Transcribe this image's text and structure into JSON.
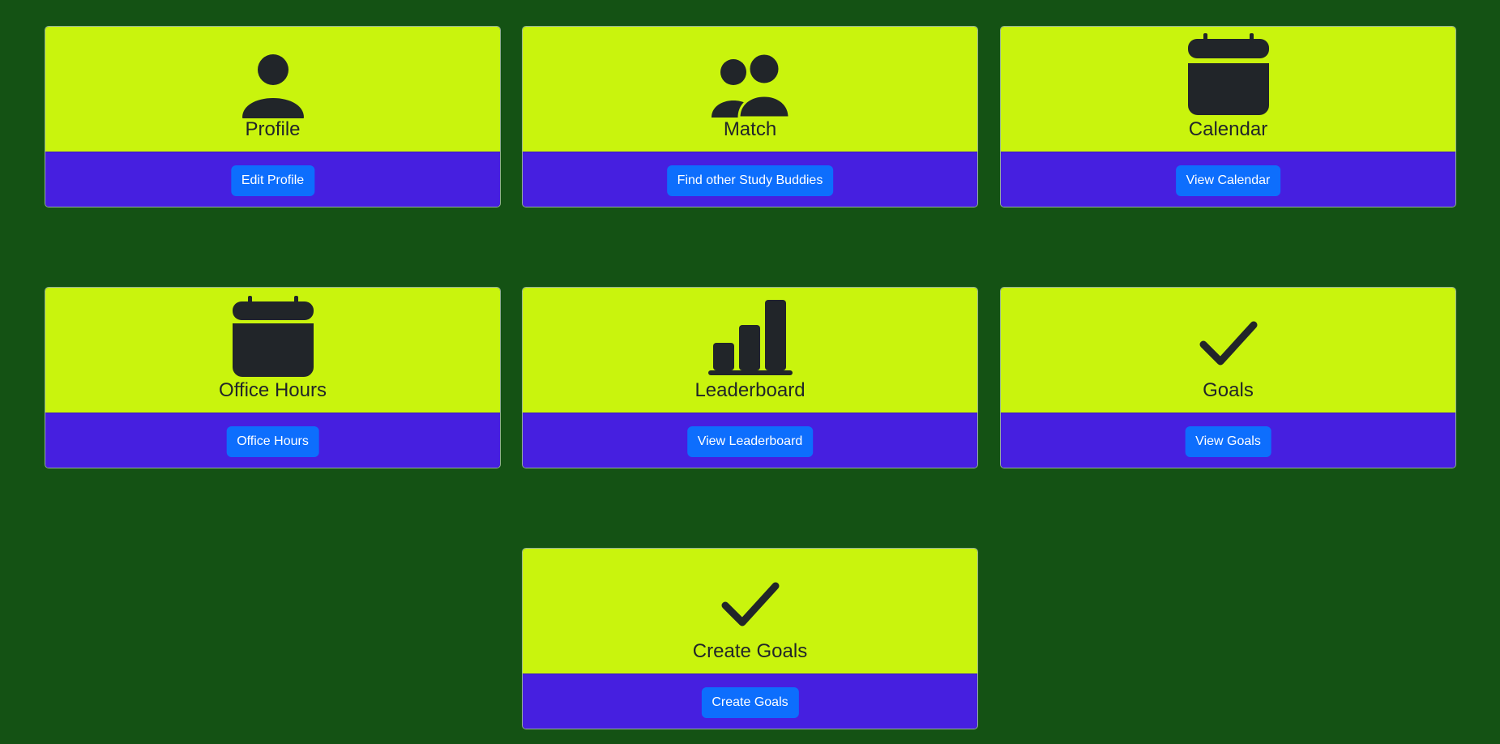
{
  "colors": {
    "background": "#145214",
    "card_top": "#c9f40d",
    "card_footer": "#461fe0",
    "button": "#0d6efd",
    "icon": "#212529"
  },
  "cards": [
    {
      "title": "Profile",
      "button": "Edit Profile",
      "icon": "person-icon"
    },
    {
      "title": "Match",
      "button": "Find other Study Buddies",
      "icon": "people-icon"
    },
    {
      "title": "Calendar",
      "button": "View Calendar",
      "icon": "calendar-icon"
    },
    {
      "title": "Office Hours",
      "button": "Office Hours",
      "icon": "calendar-icon"
    },
    {
      "title": "Leaderboard",
      "button": "View Leaderboard",
      "icon": "bar-chart-icon"
    },
    {
      "title": "Goals",
      "button": "View Goals",
      "icon": "check-icon"
    },
    {
      "title": "Create Goals",
      "button": "Create Goals",
      "icon": "check-icon"
    }
  ]
}
